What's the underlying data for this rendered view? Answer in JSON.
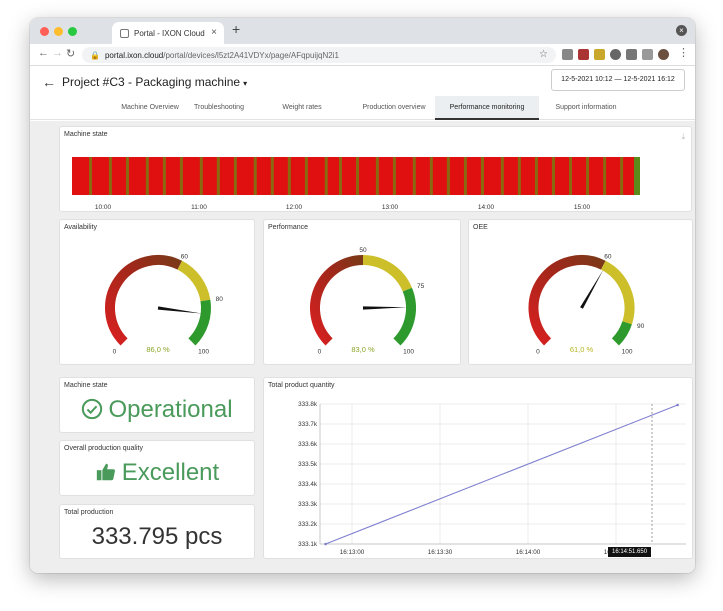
{
  "browser": {
    "tab_title": "Portal - IXON Cloud",
    "tab_close": "×",
    "new_tab": "+",
    "url_host": "portal.ixon.cloud",
    "url_path": "/portal/devices/l5zt2A41VDYx/page/AFqpuijqN2i1"
  },
  "header": {
    "back_icon": "←",
    "title": "Project #C3 - Packaging machine",
    "caret": "▾",
    "date_range": "12-5-2021 10:12 — 12-5-2021 16:12"
  },
  "tabs": [
    {
      "label": "Machine Overview"
    },
    {
      "label": "Troubleshooting"
    },
    {
      "label": "Weight rates"
    },
    {
      "label": "Production overview"
    },
    {
      "label": "Performance monitoring"
    },
    {
      "label": "Support information"
    }
  ],
  "machine_state_timeline": {
    "title": "Machine state",
    "download_icon": "download-icon",
    "x_labels": [
      "10:00",
      "11:00",
      "12:00",
      "13:00",
      "14:00",
      "15:00"
    ],
    "running_color": "#e01010",
    "idle_color": "#8a6a10",
    "end_color": "#5a8a1a"
  },
  "gauges": [
    {
      "title": "Availability",
      "value": 86.0,
      "value_label": "86,0 %",
      "min_label": "0",
      "max_label": "100",
      "mark1": "60",
      "mark2": "80",
      "value_color": "#8aa62a"
    },
    {
      "title": "Performance",
      "value": 83.0,
      "value_label": "83,0 %",
      "min_label": "0",
      "max_label": "100",
      "mark1": "50",
      "mark2": "75",
      "value_color": "#8aa62a"
    },
    {
      "title": "OEE",
      "value": 61.0,
      "value_label": "61,0 %",
      "min_label": "0",
      "max_label": "100",
      "mark1": "60",
      "mark2": "90",
      "value_color": "#b5b520"
    }
  ],
  "status_cards": {
    "machine_state": {
      "title": "Machine state",
      "value": "Operational"
    },
    "quality": {
      "title": "Overall production quality",
      "value": "Excellent"
    },
    "total": {
      "title": "Total production",
      "value": "333.795 pcs"
    }
  },
  "colors": {
    "accent_green": "#4a9a5b",
    "line": "#8080d0"
  },
  "chart_data": {
    "type": "line",
    "title": "Total product quantity",
    "x": [
      "16:12:51",
      "16:14:51"
    ],
    "y": [
      333.1,
      333.795
    ],
    "x_tick_labels": [
      "16:13:00",
      "16:13:30",
      "16:14:00",
      "16:14:30"
    ],
    "y_tick_labels": [
      "333.1k",
      "333.2k",
      "333.3k",
      "333.4k",
      "333.5k",
      "333.6k",
      "333.7k",
      "333.8k"
    ],
    "ylim": [
      333100,
      333800
    ],
    "grid": true,
    "tooltip": "16:14:51.650"
  }
}
